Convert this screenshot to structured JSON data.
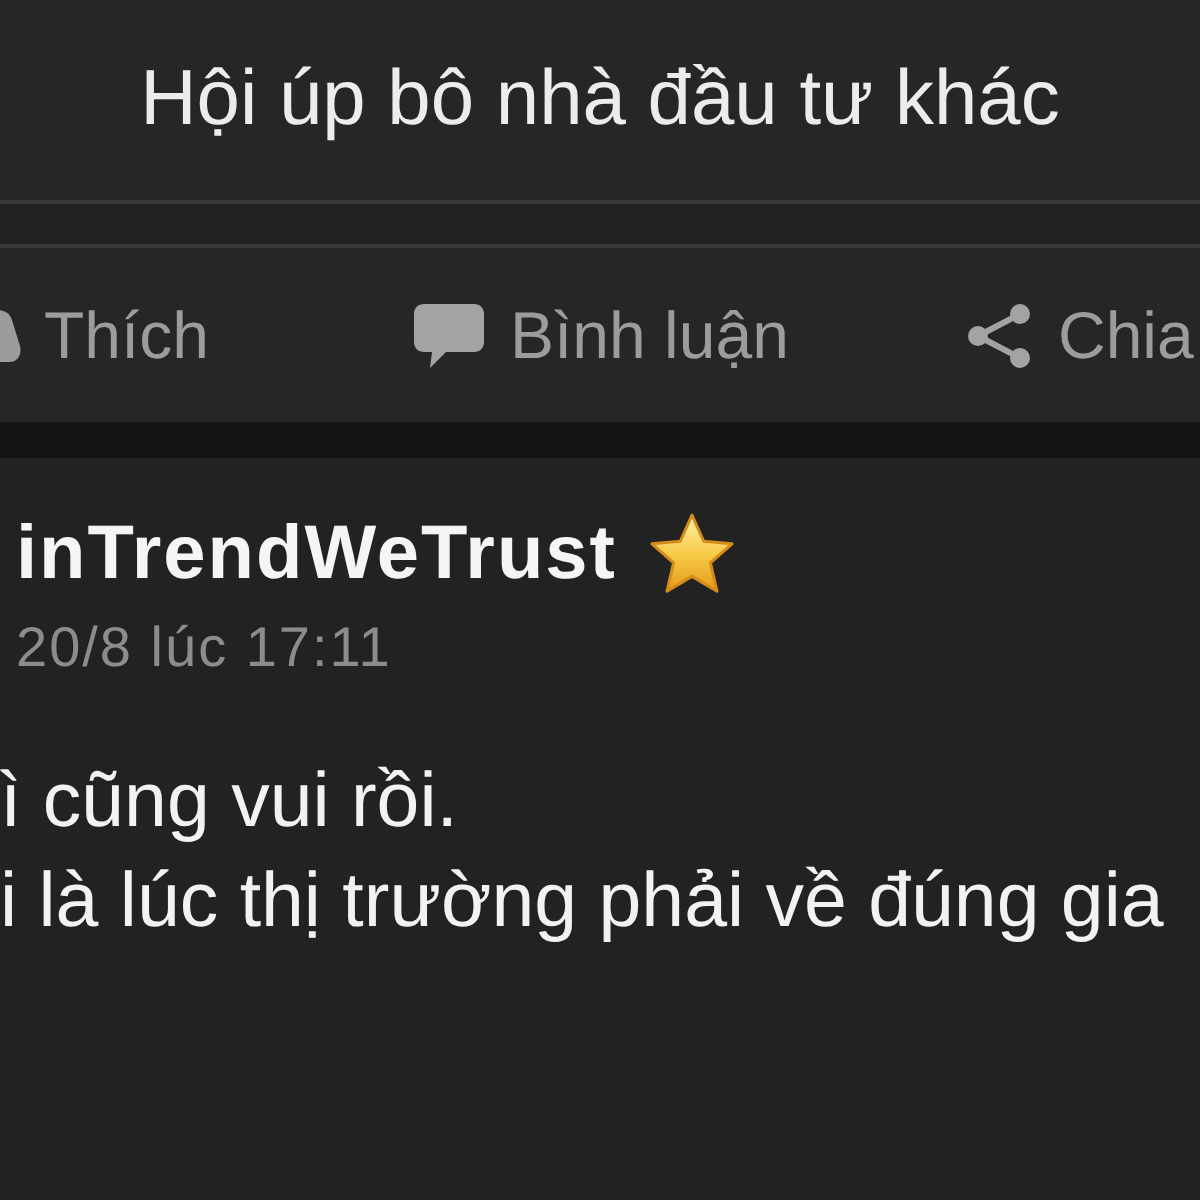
{
  "header": {
    "title": "Hội úp bô nhà đầu tư khác"
  },
  "actions": [
    {
      "kind": "like",
      "label": "Thích"
    },
    {
      "kind": "comment",
      "label": "Bình luận"
    },
    {
      "kind": "share",
      "label": "Chia"
    }
  ],
  "post": {
    "author": "inTrendWeTrust",
    "time": "20/8 lúc 17:11",
    "body_lines": [
      "ì cũng vui rồi.",
      "i là lúc thị trường phải về đúng gia"
    ]
  }
}
